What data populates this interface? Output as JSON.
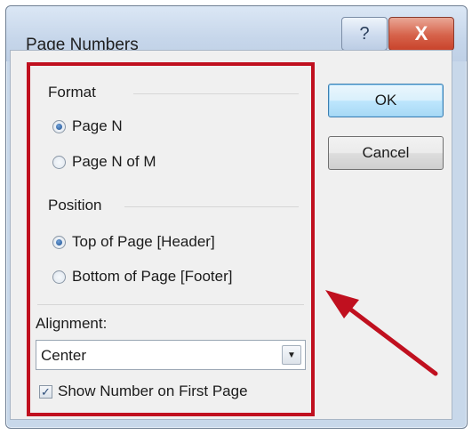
{
  "dialog": {
    "title": "Page Numbers",
    "help_glyph": "?",
    "close_glyph": "X"
  },
  "format": {
    "label": "Format",
    "options": [
      {
        "label": "Page N",
        "checked": true
      },
      {
        "label": "Page N of M",
        "checked": false
      }
    ]
  },
  "position": {
    "label": "Position",
    "options": [
      {
        "label": "Top of Page [Header]",
        "checked": true
      },
      {
        "label": "Bottom of Page [Footer]",
        "checked": false
      }
    ]
  },
  "alignment": {
    "label": "Alignment:",
    "value": "Center"
  },
  "first_page": {
    "label": "Show Number on First Page",
    "checked": true
  },
  "buttons": {
    "ok": "OK",
    "cancel": "Cancel"
  },
  "annotation": {
    "highlight_color": "#c0101f",
    "arrow_color": "#c0101f"
  },
  "icons": {
    "help": "help-icon",
    "close": "close-icon",
    "dropdown": "chevron-down-icon",
    "check": "checkmark-icon"
  }
}
